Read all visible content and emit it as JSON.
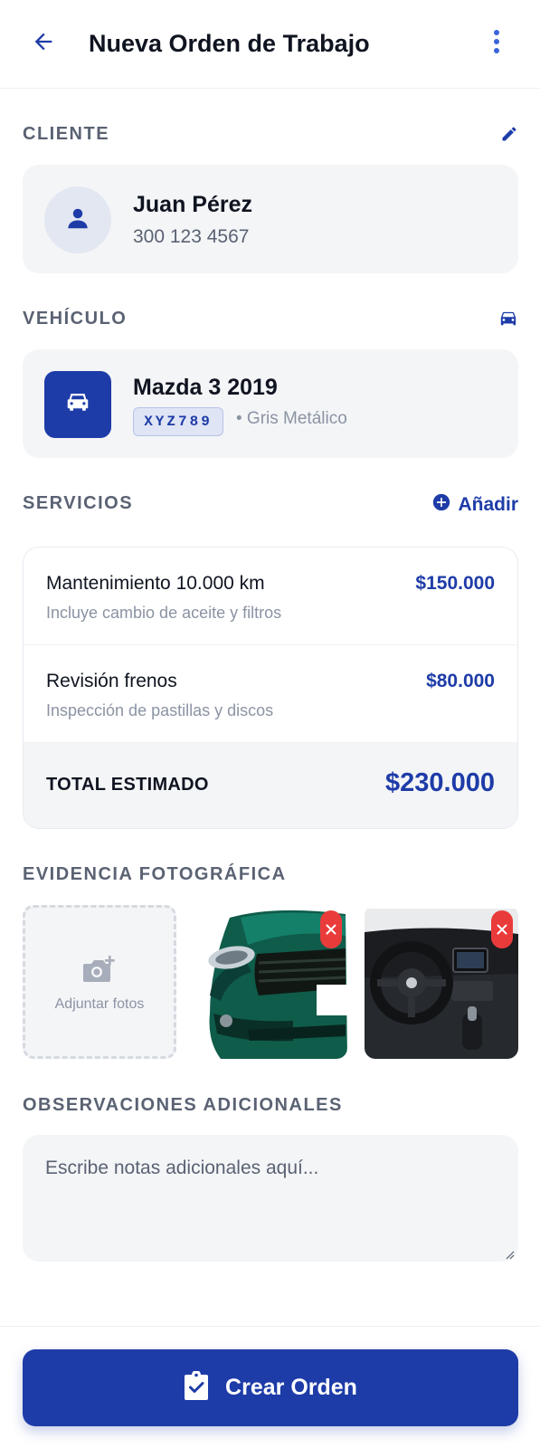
{
  "header": {
    "title": "Nueva Orden de Trabajo",
    "back_icon": "arrow-left-icon",
    "menu_icon": "more-vertical-icon"
  },
  "client": {
    "label": "CLIENTE",
    "name": "Juan Pérez",
    "phone": "300 123 4567",
    "edit_icon": "pencil-icon",
    "avatar_icon": "person-icon"
  },
  "vehicle": {
    "label": "VEHÍCULO",
    "name": "Mazda 3 2019",
    "plate": "XYZ789",
    "color": "• Gris Metálico",
    "header_icon": "car-icon",
    "thumb_icon": "car-front-icon"
  },
  "services": {
    "label": "SERVICIOS",
    "add_label": "Añadir",
    "items": [
      {
        "name": "Mantenimiento 10.000 km",
        "description": "Incluye cambio de aceite y filtros",
        "price": "$150.000"
      },
      {
        "name": "Revisión frenos",
        "description": "Inspección de pastillas y discos",
        "price": "$80.000"
      }
    ],
    "total_label": "TOTAL ESTIMADO",
    "total_value": "$230.000"
  },
  "photos": {
    "label": "EVIDENCIA FOTOGRÁFICA",
    "add_label": "Adjuntar fotos",
    "items": [
      {
        "subject": "car-front-photo"
      },
      {
        "subject": "car-interior-photo"
      }
    ]
  },
  "notes": {
    "label": "OBSERVACIONES ADICIONALES",
    "placeholder": "Escribe notas adicionales aquí...",
    "value": ""
  },
  "footer": {
    "button_label": "Crear Orden",
    "button_icon": "clipboard-check-icon"
  },
  "colors": {
    "primary": "#1e3ca8",
    "danger": "#ea3b3b",
    "card_bg": "#f4f5f7",
    "muted": "#5a6273"
  }
}
